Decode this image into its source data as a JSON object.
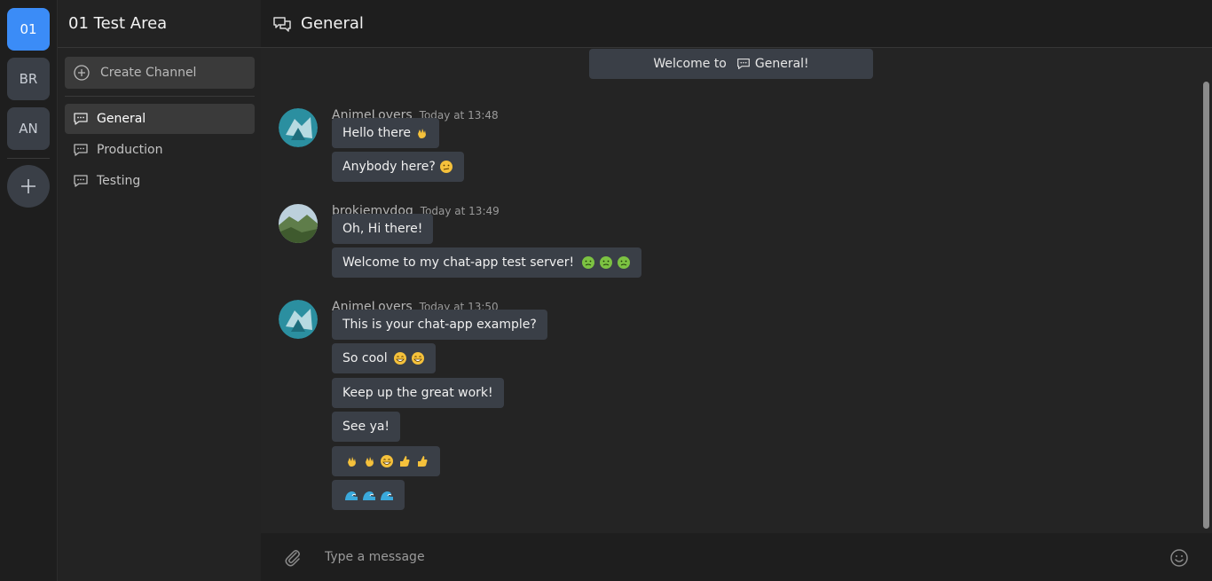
{
  "servers": [
    {
      "label": "01",
      "active": true
    },
    {
      "label": "BR",
      "active": false
    },
    {
      "label": "AN",
      "active": false
    }
  ],
  "sidebar": {
    "server_title": "01 Test Area",
    "create_channel_label": "Create Channel",
    "channels": [
      {
        "label": "General",
        "active": true
      },
      {
        "label": "Production",
        "active": false
      },
      {
        "label": "Testing",
        "active": false
      }
    ]
  },
  "header": {
    "channel_title": "General"
  },
  "chat": {
    "welcome_prefix": "Welcome to",
    "welcome_channel": "General!",
    "groups": [
      {
        "author": "AnimeLovers",
        "time": "Today at 13:48",
        "messages": [
          "Hello there",
          "Anybody here?"
        ]
      },
      {
        "author": "brokiemydog",
        "time": "Today at 13:49",
        "messages": [
          "Oh, Hi there!",
          "Welcome to my chat-app test server!"
        ]
      },
      {
        "author": "AnimeLovers",
        "time": "Today at 13:50",
        "messages": [
          "This is your chat-app example?",
          "So cool",
          "Keep up the great work!",
          "See ya!",
          "",
          ""
        ]
      }
    ]
  },
  "composer": {
    "placeholder": "Type a message"
  },
  "emoji_names": {
    "wave": "waving-hand-emoji",
    "confused": "confused-face-emoji",
    "nauseated": "nauseated-face-emoji",
    "grin": "grinning-face-emoji",
    "thumbs": "thumbs-up-emoji",
    "wave_water": "water-wave-emoji"
  },
  "colors": {
    "accent": "#3b8cf7",
    "bubble": "#3a3f47",
    "background": "#242424"
  }
}
